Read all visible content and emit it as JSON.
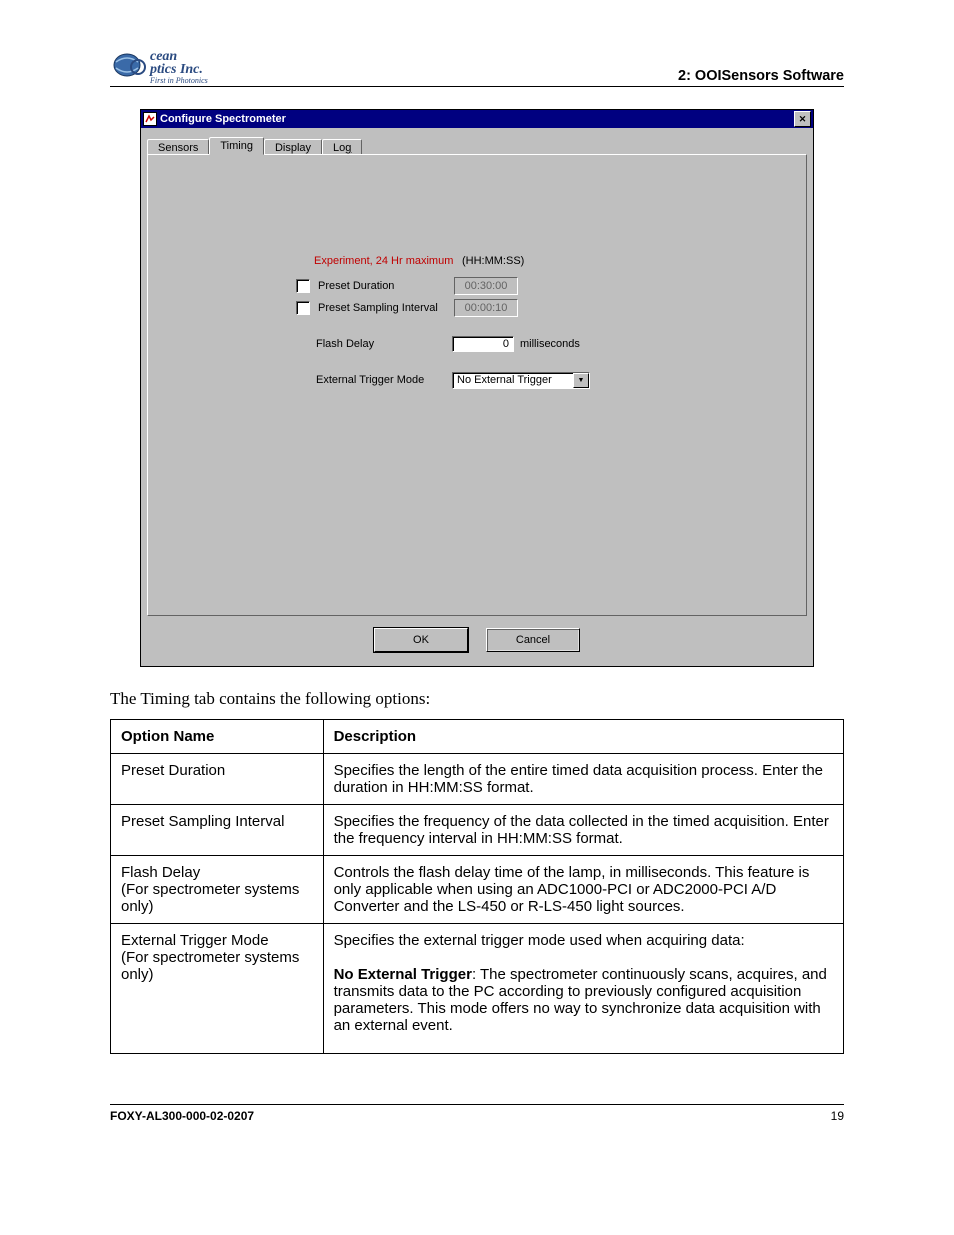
{
  "header": {
    "logo_top": "cean",
    "logo_bottom": "ptics Inc.",
    "logo_tag": "First in Photonics",
    "section_title": "2: OOISensors Software"
  },
  "dialog": {
    "title": "Configure Spectrometer",
    "close_glyph": "✕",
    "tabs": {
      "sensors": "Sensors",
      "timing": "Timing",
      "display": "Display",
      "log": "Log",
      "log_prefix": "Lo",
      "log_under": "g"
    },
    "form": {
      "experiment_label": "Experiment, 24 Hr maximum",
      "hhmmss_label": "(HH:MM:SS)",
      "preset_duration_label": "Preset Duration",
      "preset_duration_value": "00:30:00",
      "preset_sampling_label": "Preset Sampling Interval",
      "preset_sampling_value": "00:00:10",
      "flash_delay_label": "Flash Delay",
      "flash_delay_value": "0",
      "flash_delay_unit": "milliseconds",
      "ext_trigger_label": "External Trigger Mode",
      "ext_trigger_value": "No External Trigger"
    },
    "buttons": {
      "ok": "OK",
      "cancel": "Cancel"
    }
  },
  "intro_text": "The Timing tab contains the following options:",
  "table": {
    "headers": {
      "name": "Option Name",
      "desc": "Description"
    },
    "rows": [
      {
        "name": "Preset Duration",
        "desc": "Specifies the length of the entire timed data acquisition process. Enter the duration in HH:MM:SS format."
      },
      {
        "name": "Preset Sampling Interval",
        "desc": "Specifies the frequency of the data collected in the timed acquisition. Enter the frequency interval in HH:MM:SS format."
      },
      {
        "name": "Flash Delay\n(For spectrometer systems only)",
        "desc": "Controls the flash delay time of the lamp, in milliseconds. This feature is only applicable when using an ADC1000-PCI or ADC2000-PCI A/D Converter and the LS-450 or R-LS-450 light sources."
      },
      {
        "name": "External Trigger Mode\n(For spectrometer systems only)",
        "desc_intro": "Specifies the external trigger mode used when acquiring data:",
        "desc_bold": "No External Trigger",
        "desc_rest": ": The spectrometer continuously scans, acquires, and transmits data to the PC according to previously configured acquisition parameters. This mode offers no way to synchronize data acquisition with an external event."
      }
    ]
  },
  "footer": {
    "doc_code": "FOXY-AL300-000-02-0207",
    "page_num": "19"
  }
}
